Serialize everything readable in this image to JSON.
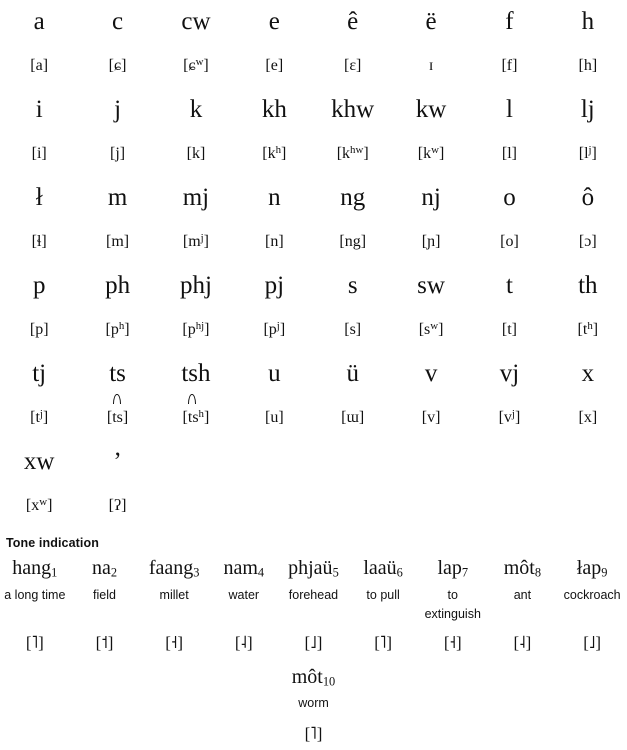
{
  "alphabet": {
    "rows": [
      {
        "letters": [
          "a",
          "c",
          "cw",
          "e",
          "ê",
          "ë",
          "f",
          "h"
        ],
        "ipa": [
          "[a]",
          "[ɕ]",
          "[ɕʷ]",
          "[e]",
          "[ɛ]",
          "ɪ",
          "[f]",
          "[h]"
        ]
      },
      {
        "letters": [
          "i",
          "j",
          "k",
          "kh",
          "khw",
          "kw",
          "l",
          "lj"
        ],
        "ipa": [
          "[i]",
          "[j]",
          "[k]",
          "[kʰ]",
          "[kʰʷ]",
          "[kʷ]",
          "[l]",
          "[lʲ]"
        ]
      },
      {
        "letters": [
          "ł",
          "m",
          "mj",
          "n",
          "ng",
          "nj",
          "o",
          "ô"
        ],
        "ipa": [
          "[ɬ]",
          "[m]",
          "[mʲ]",
          "[n]",
          "[ng]",
          "[ɲ]",
          "[o]",
          "[ɔ]"
        ]
      },
      {
        "letters": [
          "p",
          "ph",
          "phj",
          "pj",
          "s",
          "sw",
          "t",
          "th"
        ],
        "ipa": [
          "[p]",
          "[pʰ]",
          "[pʰʲ]",
          "[pʲ]",
          "[s]",
          "[sʷ]",
          "[t]",
          "[tʰ]"
        ]
      },
      {
        "letters": [
          "tj",
          "ts",
          "tsh",
          "u",
          "ü",
          "v",
          "vj",
          "x"
        ],
        "ipa": [
          "[tʲ]",
          "[t͡s]",
          "[t͡sʰ]",
          "[u]",
          "[ɯ]",
          "[v]",
          "[vʲ]",
          "[x]"
        ]
      },
      {
        "letters": [
          "xw",
          "ʼ",
          "",
          "",
          "",
          "",
          "",
          ""
        ],
        "ipa": [
          "[xʷ]",
          "[ʔ]",
          "",
          "",
          "",
          "",
          "",
          ""
        ]
      }
    ],
    "display_rows": [
      {
        "letters": [
          "a",
          "c",
          "cw",
          "e",
          "ê",
          "ë",
          "f",
          "h"
        ],
        "ipa": [
          "[a]",
          "[ɕ]",
          "[ɕʷ]",
          "[e]",
          "[ɛ]",
          "ɪ",
          "[f]",
          "[h]"
        ],
        "ipa_sup": [
          "",
          "",
          "w",
          "",
          "",
          "",
          "",
          ""
        ]
      },
      {
        "letters": [
          "i",
          "j",
          "k",
          "kh",
          "khw",
          "kw",
          "l",
          "lj"
        ],
        "ipa": [
          "[i]",
          "[j]",
          "[k]",
          "[kʰ]",
          "[kʰʷ]",
          "[kʷ]",
          "[l]",
          "[lʲ]"
        ],
        "ipa_sup": [
          "",
          "",
          "",
          "h",
          "hw",
          "w",
          "",
          "j"
        ]
      }
    ]
  },
  "grid": [
    [
      {
        "letter": "a",
        "base": "[a",
        "sup": "",
        "tail": "]",
        "tie": false
      },
      {
        "letter": "c",
        "base": "[ɕ",
        "sup": "",
        "tail": "]",
        "tie": false
      },
      {
        "letter": "cw",
        "base": "[ɕ",
        "sup": "w",
        "tail": "]",
        "tie": false
      },
      {
        "letter": "e",
        "base": "[e",
        "sup": "",
        "tail": "]",
        "tie": false
      },
      {
        "letter": "ê",
        "base": "[ɛ",
        "sup": "",
        "tail": "]",
        "tie": false
      },
      {
        "letter": "ë",
        "base": "ɪ",
        "sup": "",
        "tail": "",
        "tie": false
      },
      {
        "letter": "f",
        "base": "[f",
        "sup": "",
        "tail": "]",
        "tie": false
      },
      {
        "letter": "h",
        "base": "[h",
        "sup": "",
        "tail": "]",
        "tie": false
      }
    ],
    [
      {
        "letter": "i",
        "base": "[i",
        "sup": "",
        "tail": "]",
        "tie": false
      },
      {
        "letter": "j",
        "base": "[j",
        "sup": "",
        "tail": "]",
        "tie": false
      },
      {
        "letter": "k",
        "base": "[k",
        "sup": "",
        "tail": "]",
        "tie": false
      },
      {
        "letter": "kh",
        "base": "[k",
        "sup": "h",
        "tail": "]",
        "tie": false
      },
      {
        "letter": "khw",
        "base": "[k",
        "sup": "hw",
        "tail": "]",
        "tie": false
      },
      {
        "letter": "kw",
        "base": "[k",
        "sup": "w",
        "tail": "]",
        "tie": false
      },
      {
        "letter": "l",
        "base": "[l",
        "sup": "",
        "tail": "]",
        "tie": false
      },
      {
        "letter": "lj",
        "base": "[l",
        "sup": "j",
        "tail": "]",
        "tie": false
      }
    ],
    [
      {
        "letter": "ł",
        "base": "[ɬ",
        "sup": "",
        "tail": "]",
        "tie": false
      },
      {
        "letter": "m",
        "base": "[m",
        "sup": "",
        "tail": "]",
        "tie": false
      },
      {
        "letter": "mj",
        "base": "[m",
        "sup": "j",
        "tail": "]",
        "tie": false
      },
      {
        "letter": "n",
        "base": "[n",
        "sup": "",
        "tail": "]",
        "tie": false
      },
      {
        "letter": "ng",
        "base": "[ng",
        "sup": "",
        "tail": "]",
        "tie": false
      },
      {
        "letter": "nj",
        "base": "[ɲ",
        "sup": "",
        "tail": "]",
        "tie": false
      },
      {
        "letter": "o",
        "base": "[o",
        "sup": "",
        "tail": "]",
        "tie": false
      },
      {
        "letter": "ô",
        "base": "[ɔ",
        "sup": "",
        "tail": "]",
        "tie": false
      }
    ],
    [
      {
        "letter": "p",
        "base": "[p",
        "sup": "",
        "tail": "]",
        "tie": false
      },
      {
        "letter": "ph",
        "base": "[p",
        "sup": "h",
        "tail": "]",
        "tie": false
      },
      {
        "letter": "phj",
        "base": "[p",
        "sup": "hj",
        "tail": "]",
        "tie": false
      },
      {
        "letter": "pj",
        "base": "[p",
        "sup": "j",
        "tail": "]",
        "tie": false
      },
      {
        "letter": "s",
        "base": "[s",
        "sup": "",
        "tail": "]",
        "tie": false
      },
      {
        "letter": "sw",
        "base": "[s",
        "sup": "w",
        "tail": "]",
        "tie": false
      },
      {
        "letter": "t",
        "base": "[t",
        "sup": "",
        "tail": "]",
        "tie": false
      },
      {
        "letter": "th",
        "base": "[t",
        "sup": "h",
        "tail": "]",
        "tie": false
      }
    ],
    [
      {
        "letter": "tj",
        "base": "[t",
        "sup": "j",
        "tail": "]",
        "tie": false
      },
      {
        "letter": "ts",
        "base": "ts",
        "sup": "",
        "tail": "",
        "tie": true
      },
      {
        "letter": "tsh",
        "base": "ts",
        "sup": "h",
        "tail": "",
        "tie": true
      },
      {
        "letter": "u",
        "base": "[u",
        "sup": "",
        "tail": "]",
        "tie": false
      },
      {
        "letter": "ü",
        "base": "[ɯ",
        "sup": "",
        "tail": "]",
        "tie": false
      },
      {
        "letter": "v",
        "base": "[v",
        "sup": "",
        "tail": "]",
        "tie": false
      },
      {
        "letter": "vj",
        "base": "[v",
        "sup": "j",
        "tail": "]",
        "tie": false
      },
      {
        "letter": "x",
        "base": "[x",
        "sup": "",
        "tail": "]",
        "tie": false
      }
    ],
    [
      {
        "letter": "xw",
        "base": "[x",
        "sup": "w",
        "tail": "]",
        "tie": false
      },
      {
        "letter": "’",
        "base": "[ʔ",
        "sup": "",
        "tail": "]",
        "tie": false
      },
      {
        "letter": "",
        "base": "",
        "sup": "",
        "tail": "",
        "tie": false
      },
      {
        "letter": "",
        "base": "",
        "sup": "",
        "tail": "",
        "tie": false
      },
      {
        "letter": "",
        "base": "",
        "sup": "",
        "tail": "",
        "tie": false
      },
      {
        "letter": "",
        "base": "",
        "sup": "",
        "tail": "",
        "tie": false
      },
      {
        "letter": "",
        "base": "",
        "sup": "",
        "tail": "",
        "tie": false
      },
      {
        "letter": "",
        "base": "",
        "sup": "",
        "tail": "",
        "tie": false
      }
    ]
  ],
  "tone": {
    "heading": "Tone indication",
    "entries": [
      {
        "word": "hang",
        "number": "1",
        "gloss": "a long time",
        "mark": "[˥]"
      },
      {
        "word": "na",
        "number": "2",
        "gloss": "field",
        "mark": "[˦]"
      },
      {
        "word": "faang",
        "number": "3",
        "gloss": "millet",
        "mark": "[˧]"
      },
      {
        "word": "nam",
        "number": "4",
        "gloss": "water",
        "mark": "[˨]"
      },
      {
        "word": "phjaü",
        "number": "5",
        "gloss": "forehead",
        "mark": "[˩]"
      },
      {
        "word": "laaü",
        "number": "6",
        "gloss": "to pull",
        "mark": "[˥]"
      },
      {
        "word": "lap",
        "number": "7",
        "gloss": "to extinguish",
        "mark": "[˧]"
      },
      {
        "word": "môt",
        "number": "8",
        "gloss": "ant",
        "mark": "[˨]"
      },
      {
        "word": "łap",
        "number": "9",
        "gloss": "cockroach",
        "mark": "[˩]"
      }
    ],
    "last_entry": {
      "word": "môt",
      "number": "10",
      "gloss": "worm",
      "mark": "[˥]"
    }
  },
  "colors": {
    "text": "#111111",
    "background": "#ffffff"
  }
}
